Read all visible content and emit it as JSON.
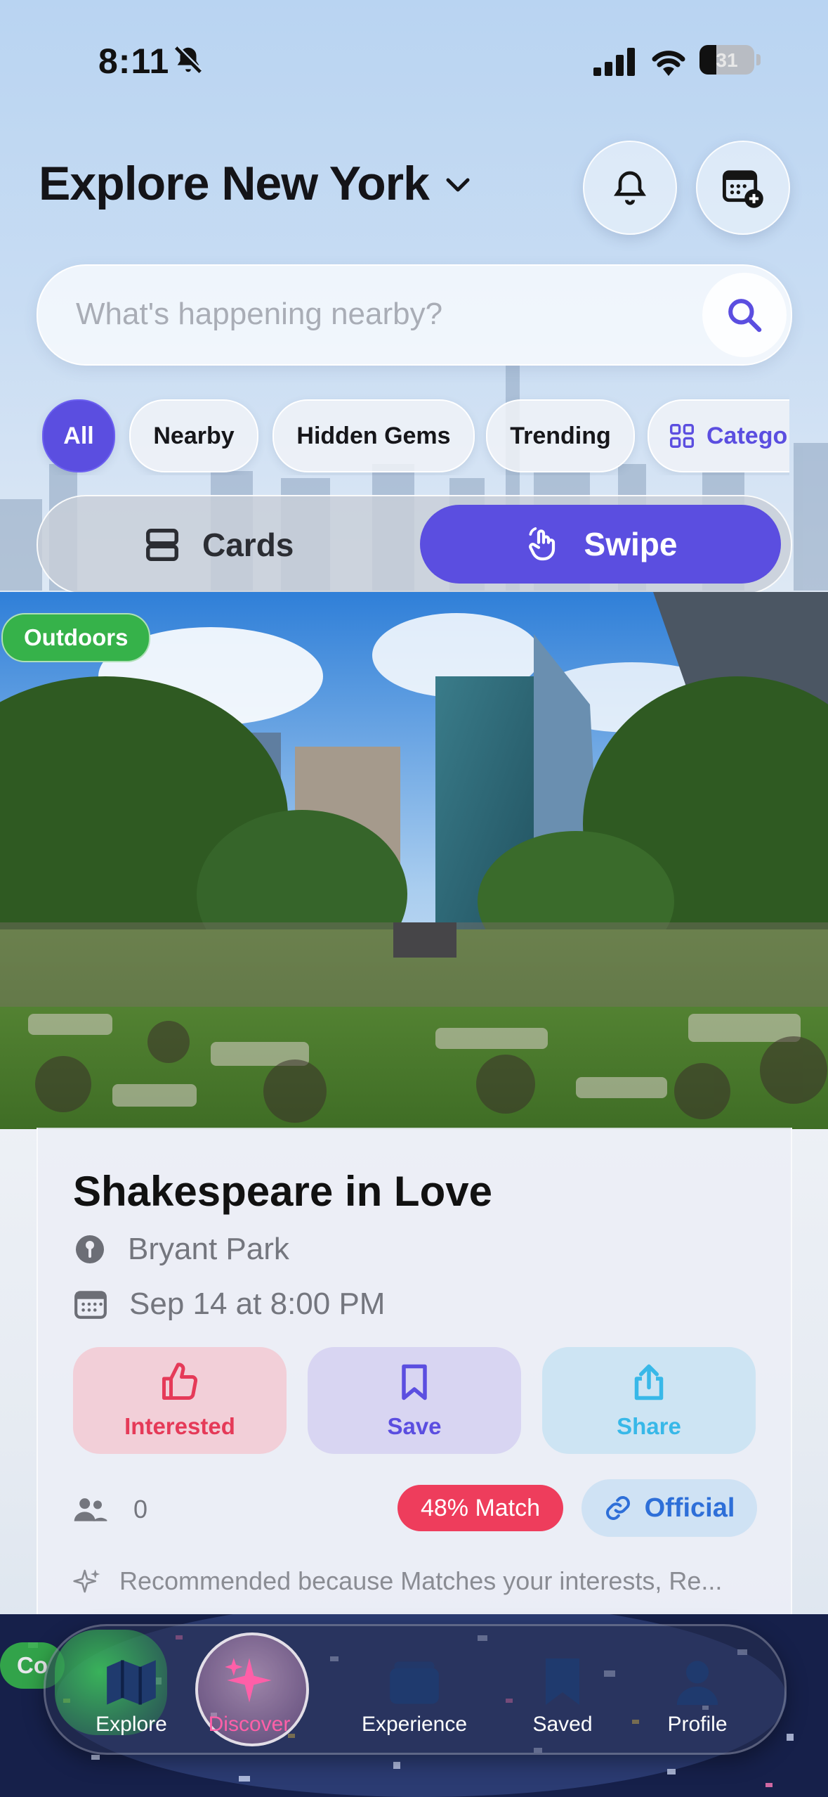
{
  "status_bar": {
    "time": "8:11",
    "battery": "31",
    "battery_level": 0.31
  },
  "header": {
    "title": "Explore New York"
  },
  "search": {
    "placeholder": "What's happening nearby?"
  },
  "filters": [
    {
      "label": "All",
      "active": true
    },
    {
      "label": "Nearby",
      "active": false
    },
    {
      "label": "Hidden Gems",
      "active": false
    },
    {
      "label": "Trending",
      "active": false
    },
    {
      "label": "Catego",
      "active": false
    }
  ],
  "view_toggle": {
    "cards_label": "Cards",
    "swipe_label": "Swipe",
    "selected": "Swipe"
  },
  "event": {
    "category": "Outdoors",
    "title": "Shakespeare in Love",
    "location": "Bryant Park",
    "datetime": "Sep 14 at 8:00 PM",
    "actions": {
      "interested": "Interested",
      "save": "Save",
      "share": "Share"
    },
    "attendees": "0",
    "match": "48% Match",
    "official": "Official",
    "recommendation": "Recommended because Matches your interests, Re..."
  },
  "next_card": {
    "category_partial": "Co"
  },
  "tab_bar": [
    {
      "label": "Explore",
      "icon": "map-icon"
    },
    {
      "label": "Discover",
      "icon": "sparkles-icon",
      "active": true
    },
    {
      "label": "Experience",
      "icon": "ticket-icon"
    },
    {
      "label": "Saved",
      "icon": "bookmark-icon"
    },
    {
      "label": "Profile",
      "icon": "person-icon"
    }
  ],
  "colors": {
    "accent": "#5b4ee0",
    "match": "#ee3d5c",
    "interested": "#e53a58",
    "share": "#38b8e8",
    "tag_green": "#36b24a",
    "discover_active": "#ff5fa8"
  }
}
